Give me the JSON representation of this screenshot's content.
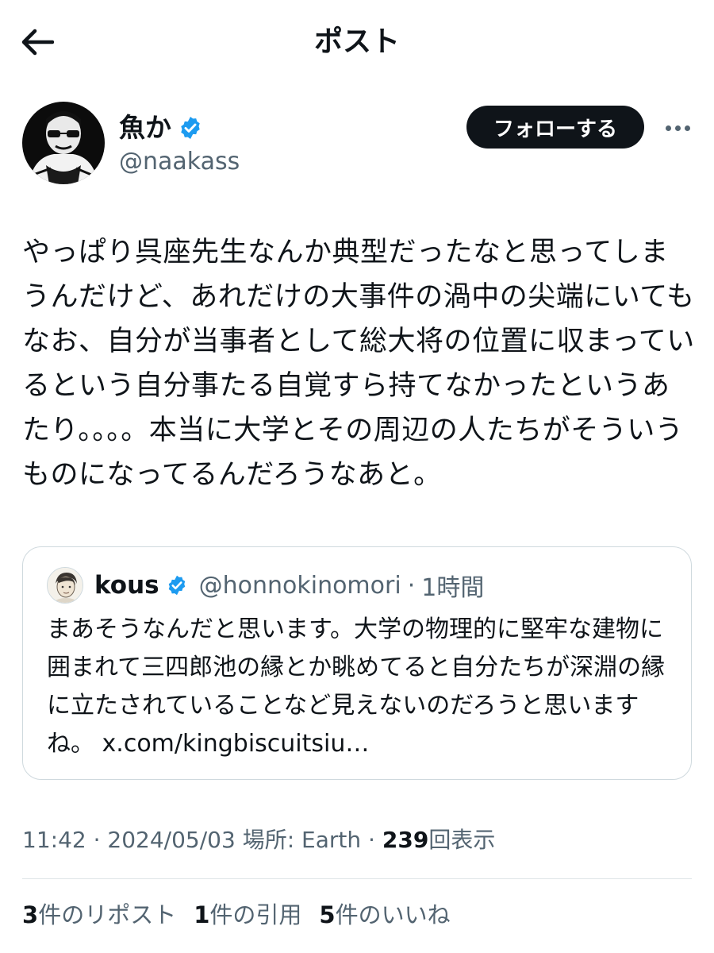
{
  "header": {
    "title": "ポスト"
  },
  "author": {
    "display_name": "魚か",
    "handle": "@naakass",
    "follow_label": "フォローする"
  },
  "post": {
    "text": "やっぱり呉座先生なんか典型だったなと思ってしまうんだけど、あれだけの大事件の渦中の尖端にいてもなお、自分が当事者として総大将の位置に収まっているという自分事たる自覚すら持てなかったというあたり。。。。本当に大学とその周辺の人たちがそういうものになってるんだろうなあと。"
  },
  "quote": {
    "display_name": "kous",
    "handle": "@honnokinomori",
    "separator": "·",
    "time": "1時間",
    "text": "まあそうなんだと思います。大学の物理的に堅牢な建物に囲まれて三四郎池の縁とか眺めてると自分たちが深淵の縁に立たされていることなど見えないのだろうと思いますね。",
    "link": "x.com/kingbiscuitsiu…"
  },
  "meta": {
    "time": "11:42",
    "sep1": "·",
    "date": "2024/05/03",
    "location": "場所: Earth",
    "sep2": "·",
    "views_count": "239",
    "views_label": "回表示"
  },
  "stats": {
    "reposts_count": "3",
    "reposts_label": "件のリポスト",
    "quotes_count": "1",
    "quotes_label": "件の引用",
    "likes_count": "5",
    "likes_label": "件のいいね"
  },
  "colors": {
    "verified": "#1d9bf0",
    "text_primary": "#0f1419",
    "text_secondary": "#536471",
    "follow_button_bg": "#0f1419",
    "border": "#cfd9de"
  },
  "icons": {
    "back": "arrow-left-icon",
    "verified": "verified-badge-icon",
    "more": "more-horizontal-icon"
  }
}
